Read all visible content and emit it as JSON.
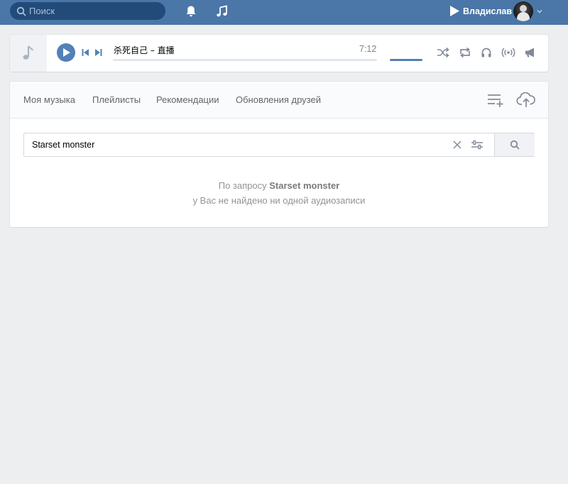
{
  "header": {
    "search_placeholder": "Поиск",
    "user_name": "Владислав",
    "bg_color": "#4a76a8"
  },
  "player": {
    "track_title": "杀死自己 – 直播",
    "duration": "7:12",
    "accent_color": "#5181b8"
  },
  "tabs": [
    {
      "label": "Моя музыка"
    },
    {
      "label": "Плейлисты"
    },
    {
      "label": "Рекомендации"
    },
    {
      "label": "Обновления друзей"
    }
  ],
  "audio_search": {
    "value": "Starset monster"
  },
  "empty_result": {
    "prefix": "По запросу ",
    "query": "Starset monster",
    "line2": "у Вас не найдено ни одной аудиозаписи"
  }
}
